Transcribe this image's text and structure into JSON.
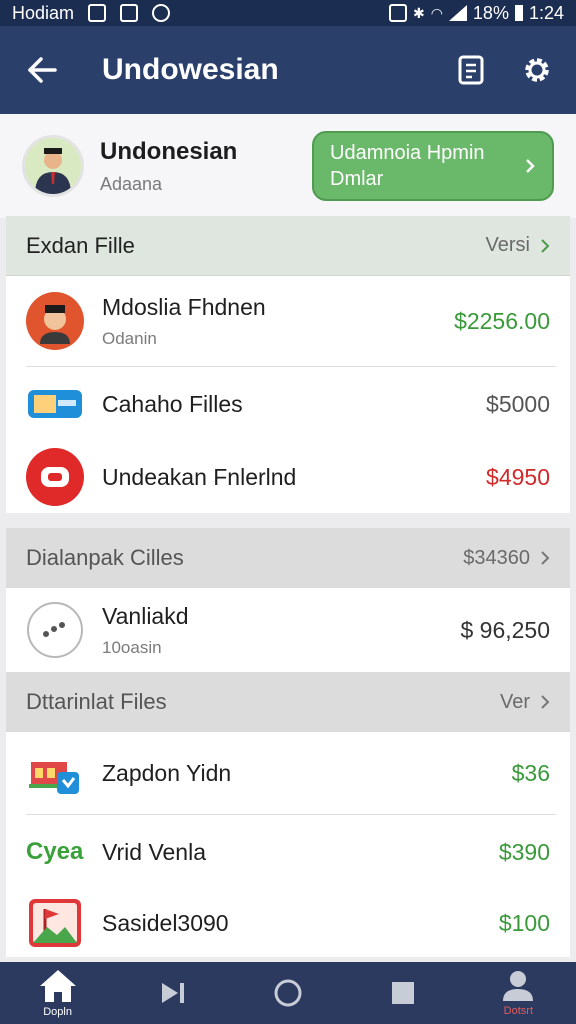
{
  "status_bar": {
    "carrier": "Hodiam",
    "battery": "18%",
    "time": "1:24"
  },
  "app_bar": {
    "title": "Undowesian"
  },
  "profile": {
    "name": "Undonesian",
    "subtitle": "Adaana",
    "button_line1": "Udamnoia Hpmin",
    "button_line2": "Dmlar"
  },
  "section1": {
    "title": "Exdan Fille",
    "link": "Versi",
    "rows": [
      {
        "title": "Mdoslia Fhdnen",
        "subtitle": "Odanin",
        "amount": "$2256.00",
        "amount_color": "#3a9a3a"
      },
      {
        "title": "Cahaho Filles",
        "subtitle": "",
        "amount": "$5000",
        "amount_color": "#555555"
      },
      {
        "title": "Undeakan Fnlerlnd",
        "subtitle": "",
        "amount": "$4950",
        "amount_color": "#d02a2a"
      }
    ]
  },
  "section2": {
    "title": "Dialanpak Cilles",
    "link": "$34360",
    "rows": [
      {
        "title": "Vanliakd",
        "subtitle": "10oasin",
        "amount": "$ 96,250",
        "amount_color": "#333333"
      }
    ]
  },
  "section3": {
    "title": "Dttarinlat Files",
    "link": "Ver",
    "rows": [
      {
        "title": "Zapdon Yidn",
        "subtitle": "",
        "amount": "$36",
        "amount_color": "#3a9a3a"
      },
      {
        "title": "Vrid Venla",
        "subtitle": "",
        "amount": "$390",
        "amount_color": "#3a9a3a",
        "icon_text": "Cyea"
      },
      {
        "title": "Sasidel3090",
        "subtitle": "",
        "amount": "$100",
        "amount_color": "#3a9a3a"
      }
    ]
  },
  "bottom_nav": {
    "home_label": "Dopln",
    "profile_label": "Dotsrt"
  },
  "colors": {
    "app_bar": "#2b3f6b",
    "accent_green": "#6ab86a",
    "negative": "#d02a2a"
  }
}
